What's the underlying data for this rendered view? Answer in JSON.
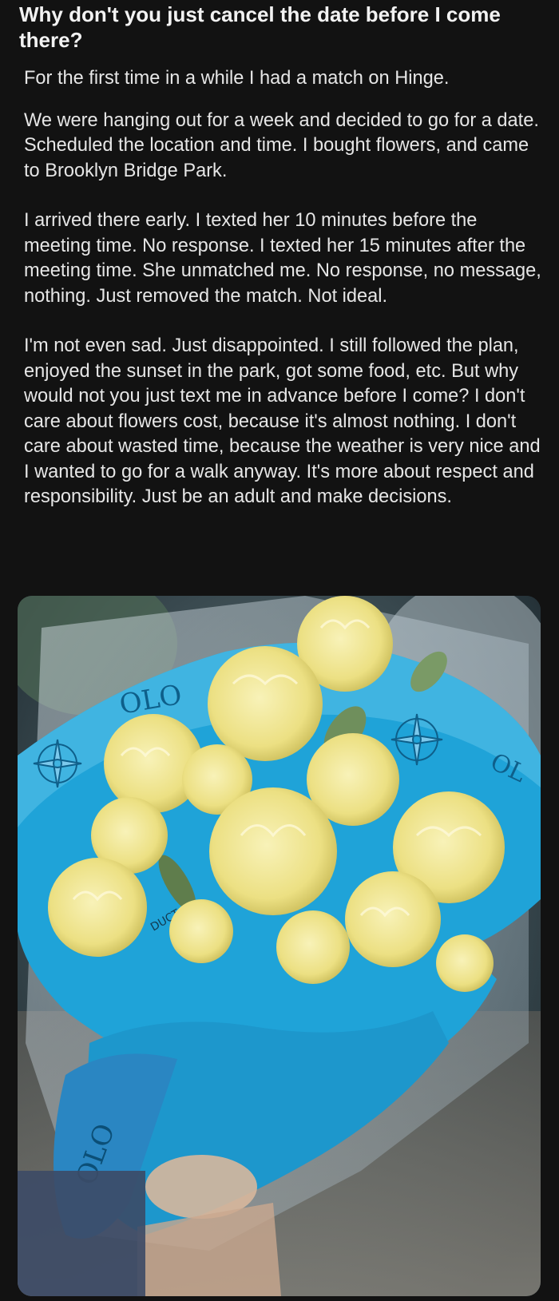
{
  "post": {
    "title": "Why don't you just cancel the date before I come there?",
    "paragraphs": [
      "For the first time in a while I had a match on Hinge.",
      "We were hanging out for a week and decided to go for a date. Scheduled the location and time. I bought flowers, and came to Brooklyn Bridge Park.",
      "I arrived there early. I texted her 10 minutes before the meeting time. No response. I texted her 15 minutes after the meeting time. She unmatched me. No response, no message, nothing. Just removed the match. Not ideal.",
      "I'm not even sad. Just disappointed. I still followed the plan, enjoyed the sunset in the park, got some food, etc. But why would not you just text me in advance before I come? I don't care about flowers cost, because it's almost nothing. I don't care about wasted time, because the weather is very nice and I wanted to go for a walk anyway. It's more about respect and responsibility. Just be an adult and make decisions."
    ],
    "photo": {
      "subject": "bouquet of yellow carnations wrapped in blue paper",
      "wrap_text": [
        "OLO",
        "OL",
        "OLO",
        "DUCT OF"
      ]
    }
  },
  "colors": {
    "background": "#121212",
    "text": "#e6e6e6",
    "title": "#f2f2f2",
    "wrap_blue": "#1fa3d8",
    "flower_yellow": "#f2eb9a"
  }
}
